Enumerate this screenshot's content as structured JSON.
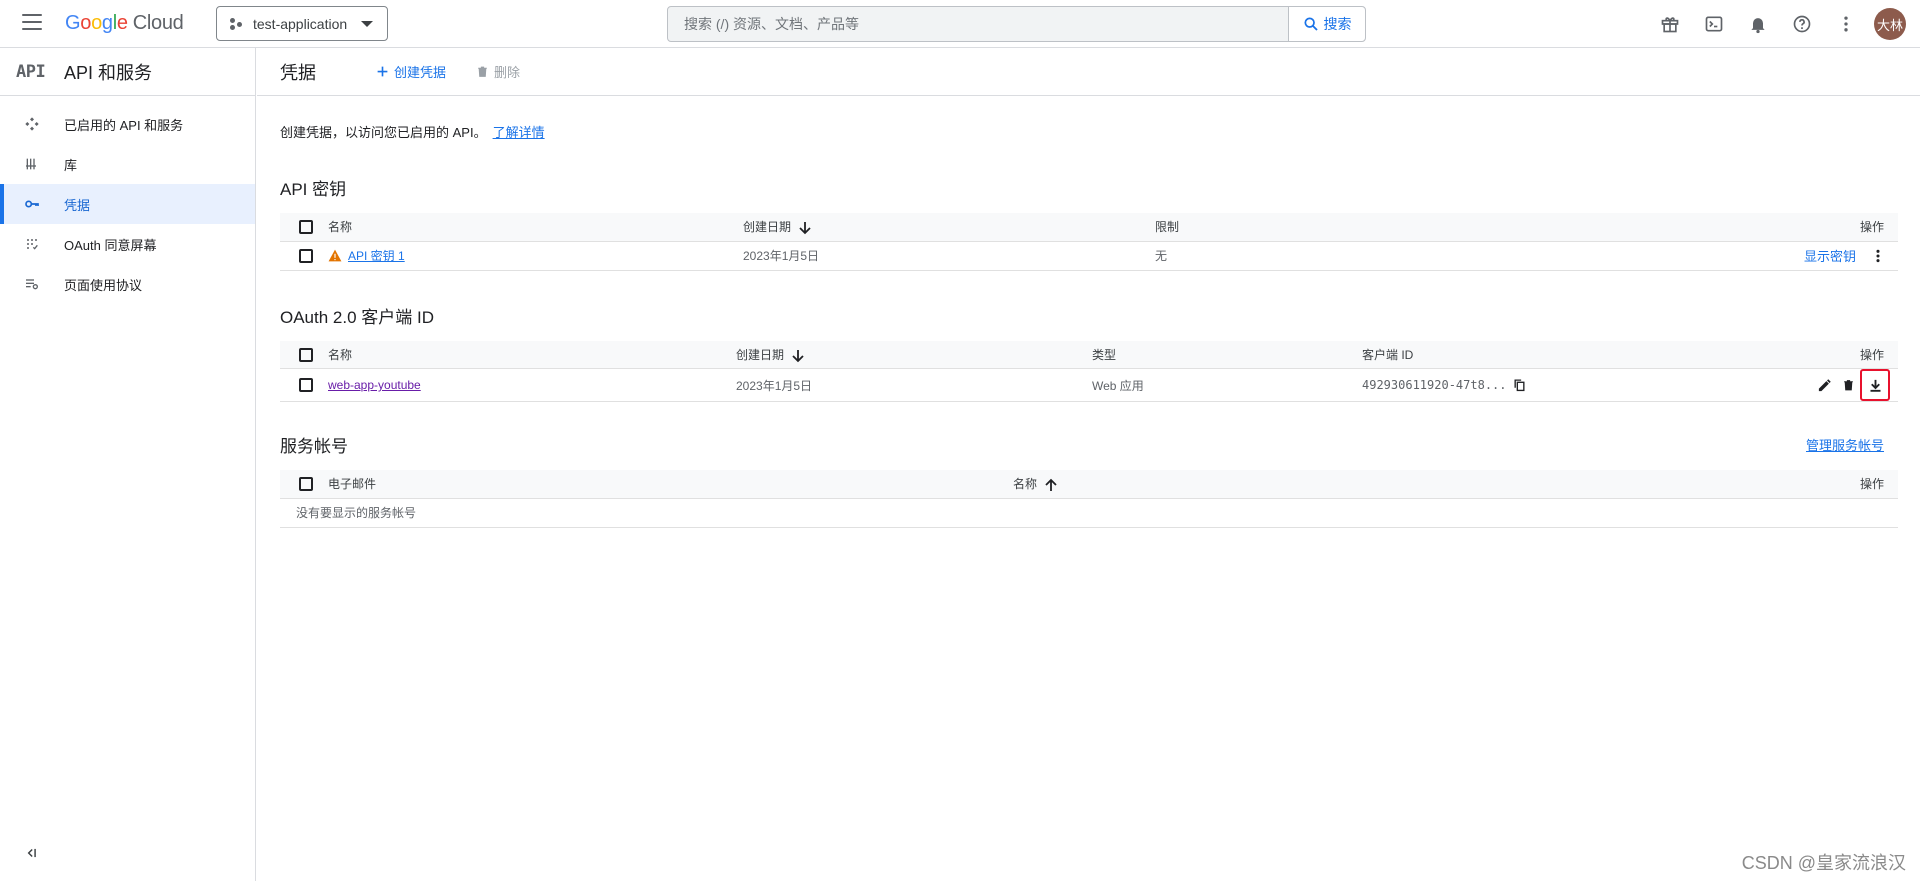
{
  "header": {
    "logo": {
      "g": "G",
      "o1": "o",
      "o2": "o",
      "g2": "g",
      "l": "l",
      "e": "e",
      "cloud": "Cloud"
    },
    "project": "test-application",
    "search_placeholder": "搜索 (/) 资源、文档、产品等",
    "search_button": "搜索",
    "icons": [
      "gift-icon",
      "terminal-icon",
      "bell-icon",
      "help-icon",
      "more-vert-icon"
    ],
    "avatar": "大林"
  },
  "sidebar": {
    "glyph": "API",
    "title": "API 和服务",
    "items": [
      {
        "label": "已启用的 API 和服务",
        "icon": "apis-icon",
        "active": false
      },
      {
        "label": "库",
        "icon": "library-icon",
        "active": true
      },
      {
        "label": "凭据",
        "icon": "key-icon",
        "active": true
      },
      {
        "label": "OAuth 同意屏幕",
        "icon": "consent-icon",
        "active": false
      },
      {
        "label": "页面使用协议",
        "icon": "agreement-icon",
        "active": false
      }
    ]
  },
  "main": {
    "title": "凭据",
    "create_label": "创建凭据",
    "delete_label": "删除",
    "intro": "创建凭据，以访问您已启用的 API。",
    "learn_more": "了解详情"
  },
  "api_keys": {
    "title": "API 密钥",
    "columns": {
      "name": "名称",
      "date": "创建日期",
      "restriction": "限制",
      "ops": "操作"
    },
    "rows": [
      {
        "name": "API 密钥 1",
        "date": "2023年1月5日",
        "restriction": "无",
        "show_key": "显示密钥"
      }
    ]
  },
  "oauth": {
    "title": "OAuth 2.0 客户端 ID",
    "columns": {
      "name": "名称",
      "date": "创建日期",
      "type": "类型",
      "client_id": "客户端 ID",
      "ops": "操作"
    },
    "rows": [
      {
        "name": "web-app-youtube",
        "date": "2023年1月5日",
        "type": "Web 应用",
        "client_id": "492930611920-47t8..."
      }
    ]
  },
  "service_accounts": {
    "title": "服务帐号",
    "manage": "管理服务帐号",
    "columns": {
      "email": "电子邮件",
      "name": "名称",
      "ops": "操作"
    },
    "empty": "没有要显示的服务帐号"
  },
  "watermark": "CSDN @皇家流浪汉",
  "colors": {
    "accent": "#1a73e8",
    "highlight": "#e8112d",
    "warning": "#e37400",
    "visited": "#681da8"
  }
}
